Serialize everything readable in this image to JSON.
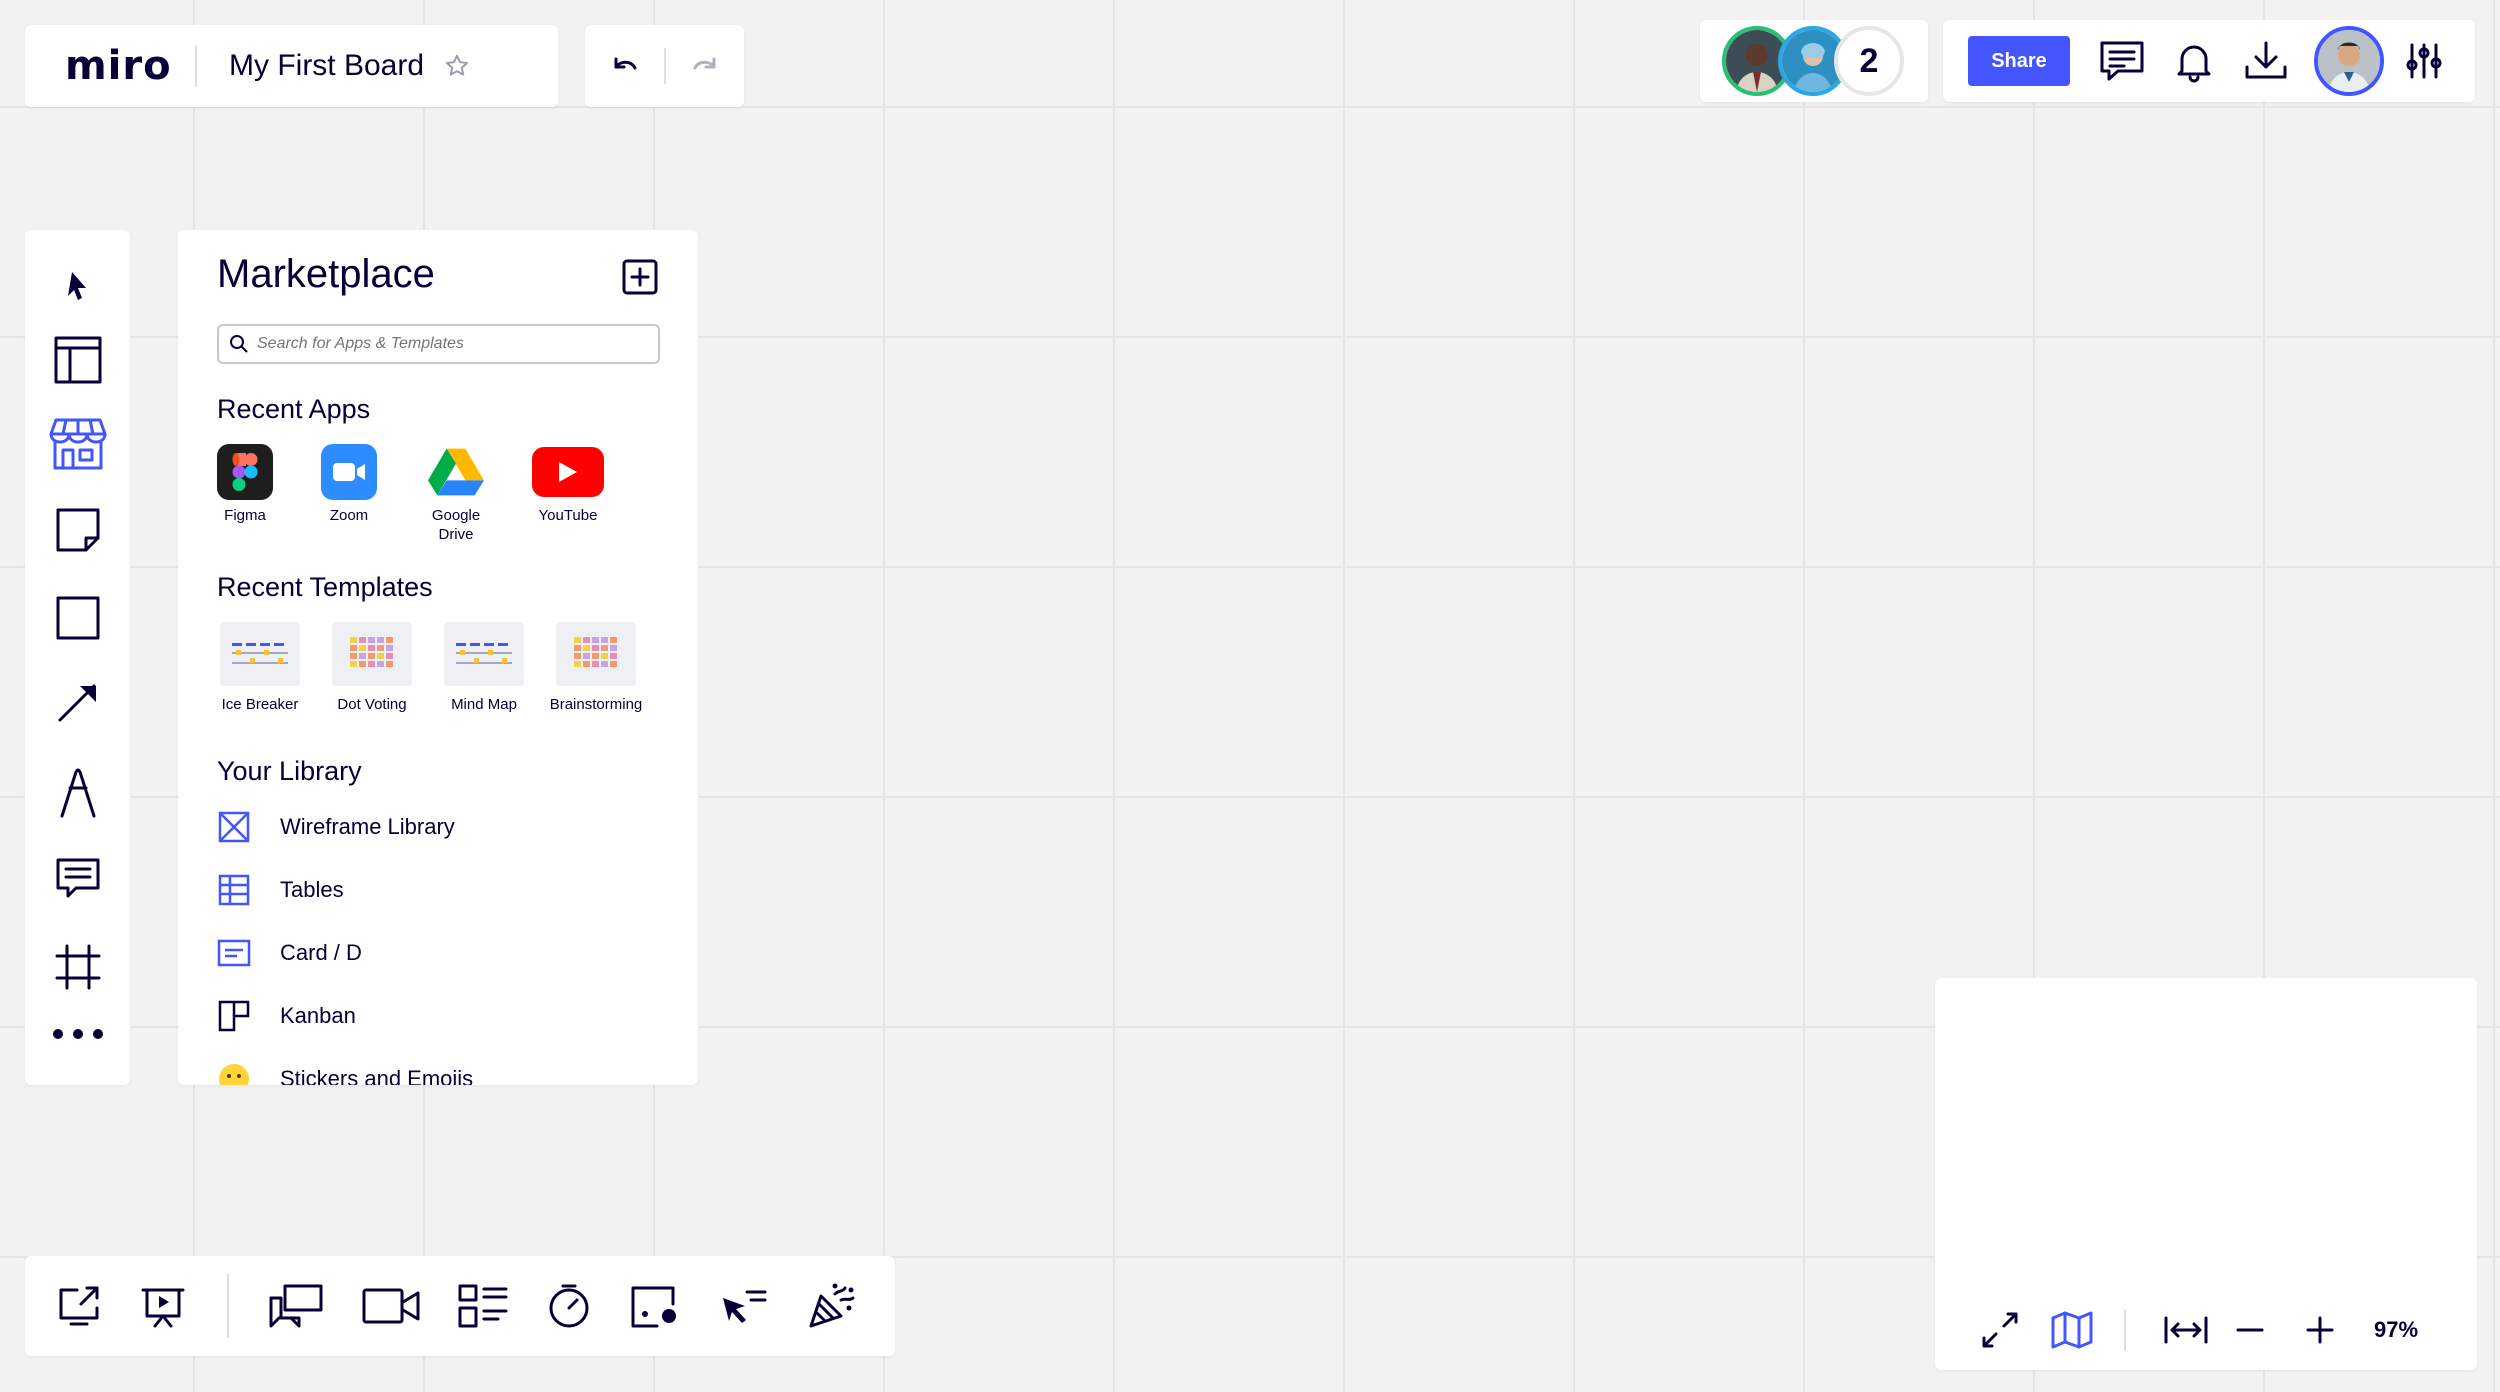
{
  "app": {
    "logo": "miro",
    "board_title": "My First Board"
  },
  "collaborators": {
    "count": "2"
  },
  "actions": {
    "share_label": "Share"
  },
  "marketplace": {
    "title": "Marketplace",
    "search_placeholder": "Search for Apps & Templates",
    "recent_apps_heading": "Recent Apps",
    "recent_apps": [
      {
        "label": "Figma",
        "icon": "figma-icon"
      },
      {
        "label": "Zoom",
        "icon": "zoom-icon"
      },
      {
        "label": "Google\nDrive",
        "icon": "google-drive-icon"
      },
      {
        "label": "YouTube",
        "icon": "youtube-icon"
      }
    ],
    "recent_templates_heading": "Recent Templates",
    "recent_templates": [
      {
        "label": "Ice Breaker"
      },
      {
        "label": "Dot Voting"
      },
      {
        "label": "Mind Map"
      },
      {
        "label": "Brainstorming"
      }
    ],
    "library_heading": "Your Library",
    "library": [
      {
        "label": "Wireframe Library",
        "icon": "wireframe-icon"
      },
      {
        "label": "Tables",
        "icon": "table-icon"
      },
      {
        "label": "Card / D",
        "icon": "card-icon"
      },
      {
        "label": "Kanban",
        "icon": "kanban-icon"
      },
      {
        "label": "Stickers and Emojis",
        "icon": "emoji-icon"
      }
    ]
  },
  "zoom": {
    "level": "97%"
  },
  "colors": {
    "accent": "#4255ff",
    "ink": "#050038",
    "canvas": "#f2f2f2"
  }
}
